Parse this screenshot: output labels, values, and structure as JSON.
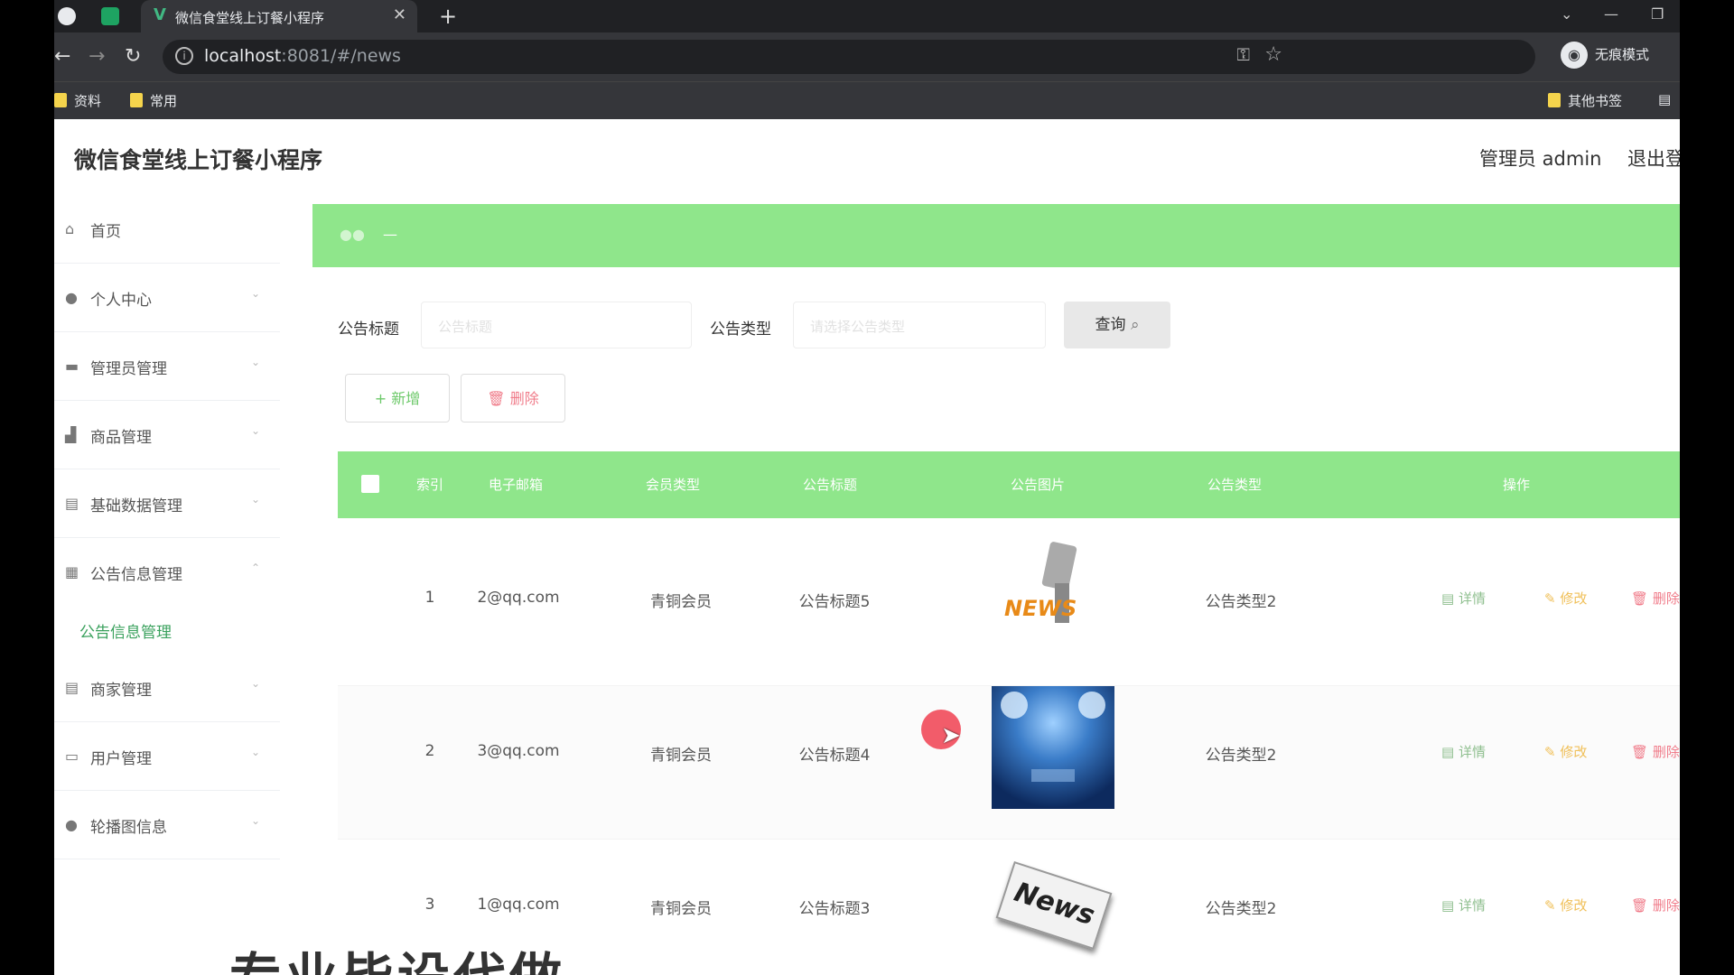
{
  "browser": {
    "tab_title": "微信食堂线上订餐小程序",
    "url_host": "localhost",
    "url_path": ":8081/#/news",
    "incognito_label": "无痕模式",
    "bookmarks": [
      "资料",
      "常用"
    ],
    "other_bookmarks": "其他书签"
  },
  "app": {
    "title": "微信食堂线上订餐小程序",
    "admin_label": "管理员 admin",
    "logout_label": "退出登录"
  },
  "sidebar": {
    "items": [
      {
        "label": "首页",
        "icon": "home-icon"
      },
      {
        "label": "个人中心",
        "icon": "user-icon"
      },
      {
        "label": "管理员管理",
        "icon": "id-card-icon"
      },
      {
        "label": "商品管理",
        "icon": "shop-icon"
      },
      {
        "label": "基础数据管理",
        "icon": "doc-icon"
      },
      {
        "label": "公告信息管理",
        "icon": "grid-icon"
      },
      {
        "label": "商家管理",
        "icon": "doc-icon"
      },
      {
        "label": "用户管理",
        "icon": "monitor-icon"
      },
      {
        "label": "轮播图信息",
        "icon": "user-icon"
      }
    ],
    "active_sub": "公告信息管理"
  },
  "search": {
    "title_label": "公告标题",
    "title_placeholder": "公告标题",
    "type_label": "公告类型",
    "type_placeholder": "请选择公告类型",
    "query_button": "查询"
  },
  "actions": {
    "add": "新增",
    "delete": "删除"
  },
  "table": {
    "headers": [
      "索引",
      "电子邮箱",
      "会员类型",
      "公告标题",
      "公告图片",
      "公告类型",
      "操作"
    ],
    "rows": [
      {
        "index": "1",
        "email": "2@qq.com",
        "member": "青铜会员",
        "title": "公告标题5",
        "type": "公告类型2"
      },
      {
        "index": "2",
        "email": "3@qq.com",
        "member": "青铜会员",
        "title": "公告标题4",
        "type": "公告类型2"
      },
      {
        "index": "3",
        "email": "1@qq.com",
        "member": "青铜会员",
        "title": "公告标题3",
        "type": "公告类型2"
      }
    ],
    "ops": {
      "detail": "详情",
      "edit": "修改",
      "delete": "删除"
    }
  },
  "images": {
    "row1_text": "NEWS",
    "row3_text": "News"
  },
  "overlay_text": "专业毕设代做",
  "colors": {
    "accent": "#8fe68b",
    "active": "#3aa15d"
  }
}
